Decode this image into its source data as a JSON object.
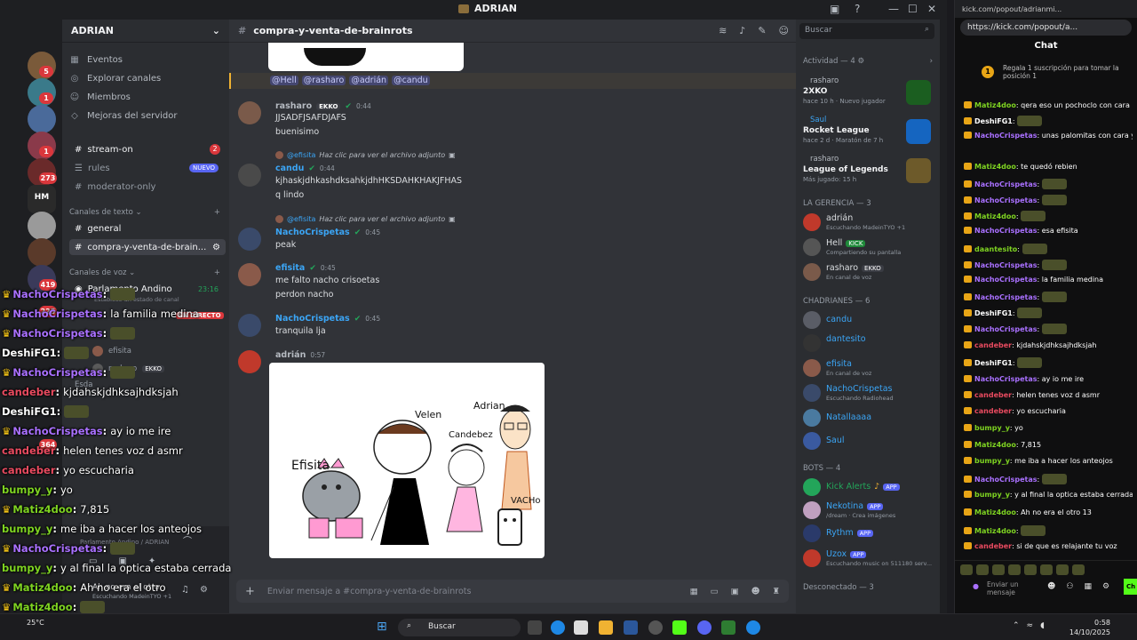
{
  "window": {
    "title": "ADRIAN"
  },
  "server": {
    "name": "ADRIAN",
    "rail_badges": [
      "5",
      "1",
      "1",
      "273",
      "HM",
      "419",
      "225",
      "364"
    ],
    "nav": [
      {
        "label": "Eventos",
        "icon": "calendar-icon"
      },
      {
        "label": "Explorar canales",
        "icon": "compass-icon"
      },
      {
        "label": "Miembros",
        "icon": "members-icon"
      },
      {
        "label": "Mejoras del servidor",
        "icon": "boost-icon"
      }
    ],
    "channels_top": [
      {
        "label": "stream-on",
        "badge": "2"
      },
      {
        "label": "rules",
        "badge": "NUEVO"
      },
      {
        "label": "moderator-only"
      }
    ],
    "text_category": "Canales de texto",
    "text_channels": [
      "general",
      "compra-y-venta-de-brain..."
    ],
    "voice_category": "Canales de voz",
    "voice_channel": {
      "name": "Parlamento Andino",
      "time": "23:16",
      "status": "Establece un estado de canal",
      "live": "EN DIRECTO"
    },
    "voice_users": [
      "efisita",
      "rasharo",
      "Esda"
    ],
    "voice_panel": {
      "line1": "Parlamento Andino / ADRIAN",
      "user": "Ah no era el otro",
      "status": "Escuchando MadeinTYO +1"
    }
  },
  "chat": {
    "channel": "compra-y-venta-de-brainrots",
    "mentions": [
      "@Hell",
      "@rasharo",
      "@adrián",
      "@candu"
    ],
    "messages": [
      {
        "author": "rasharo",
        "color": "#b5bac1",
        "time": "0:44",
        "tag": "EKKO",
        "lines": [
          "JJSADFJSAFDJAFS",
          "buenisimo"
        ]
      },
      {
        "reply_user": "@efisita",
        "reply_text": "Haz clic para ver el archivo adjunto",
        "author": "candu",
        "color": "#3ba5f5",
        "time": "0:44",
        "lines": [
          "kjhaskjdhkashdksahkjdhHKSDAHKHAKJFHAS",
          "q lindo"
        ]
      },
      {
        "reply_user": "@efisita",
        "reply_text": "Haz clic para ver el archivo adjunto",
        "author": "NachoCrispetas",
        "color": "#3ba5f5",
        "time": "0:45",
        "lines": [
          "peak"
        ]
      },
      {
        "author": "efisita",
        "color": "#3ba5f5",
        "time": "0:45",
        "lines": [
          "me falto nacho crisoetas",
          "perdon nacho"
        ]
      },
      {
        "author": "NachoCrispetas",
        "color": "#3ba5f5",
        "time": "0:45",
        "lines": [
          "tranquila lja"
        ]
      },
      {
        "author": "adrián",
        "color": "#b5bac1",
        "time": "0:57",
        "lines": []
      }
    ],
    "drawing_labels": [
      "Efisita",
      "Velen",
      "Candebez",
      "Adrian",
      "VACHo"
    ],
    "composer_placeholder": "Enviar mensaje a #compra-y-venta-de-brainrots"
  },
  "members": {
    "search_placeholder": "Buscar",
    "activity_title": "Actividad — 4",
    "activities": [
      {
        "user": "rasharo",
        "game": "2XKO",
        "sub": "hace 10 h · Nuevo jugador",
        "color": "#2e7d32"
      },
      {
        "user": "Saul",
        "game": "Rocket League",
        "sub": "hace 2 d · Maratón de 7 h",
        "color": "#1565c0"
      },
      {
        "user": "rasharo",
        "game": "League of Legends",
        "sub": "Más jugado: 15 h",
        "color": "#8d6e2a"
      }
    ],
    "gerencia_title": "LA GERENCIA — 3",
    "gerencia": [
      {
        "name": "adrián",
        "status": "Escuchando MadeinTYO +1"
      },
      {
        "name": "Hell",
        "tag": "KICK",
        "status": "Compartiendo su pantalla"
      },
      {
        "name": "rasharo",
        "tag": "EKKO",
        "status": "En canal de voz"
      }
    ],
    "chadrianes_title": "CHADRIANES — 6",
    "chadrianes": [
      {
        "name": "candu",
        "status": ""
      },
      {
        "name": "dantesito",
        "status": ""
      },
      {
        "name": "efisita",
        "status": "En canal de voz"
      },
      {
        "name": "NachoCrispetas",
        "status": "Escuchando Radiohead"
      },
      {
        "name": "Natallaaaa",
        "status": ""
      },
      {
        "name": "Saul",
        "status": ""
      }
    ],
    "bots_title": "BOTS — 4",
    "bots": [
      {
        "name": "Kick Alerts",
        "status": ""
      },
      {
        "name": "Nekotina",
        "status": "/dream · Crea imágenes"
      },
      {
        "name": "Rythm",
        "status": ""
      },
      {
        "name": "Uzox",
        "status": "Escuchando music on 511180 serv..."
      }
    ],
    "offline_title": "Desconectado — 3",
    "app_tag": "APP"
  },
  "kick": {
    "url_short": "kick.com/popout/adrianmi...",
    "url": "https://kick.com/popout/a...",
    "title": "Chat",
    "promo": "Regala 1 suscripción para tomar la posición 1",
    "messages": [
      {
        "user": "Matiz4doo",
        "color": "#7ed321",
        "text": "qera eso un pochoclo con cara"
      },
      {
        "user": "DeshiFG1",
        "color": "#ffffff",
        "text": ""
      },
      {
        "user": "NachoCrispetas",
        "color": "#a970ff",
        "text": "unas palomitas con cara y listo"
      },
      {
        "user": "Matiz4doo",
        "color": "#7ed321",
        "text": "te quedó rebien"
      },
      {
        "user": "NachoCrispetas",
        "color": "#a970ff",
        "text": ""
      },
      {
        "user": "NachoCrispetas",
        "color": "#a970ff",
        "text": ""
      },
      {
        "user": "Matiz4doo",
        "color": "#7ed321",
        "text": ""
      },
      {
        "user": "NachoCrispetas",
        "color": "#a970ff",
        "text": "esa efisita"
      },
      {
        "user": "daantesito",
        "color": "#7ed321",
        "text": ""
      },
      {
        "user": "NachoCrispetas",
        "color": "#a970ff",
        "text": ""
      },
      {
        "user": "NachoCrispetas",
        "color": "#a970ff",
        "text": "la familia medina"
      },
      {
        "user": "NachoCrispetas",
        "color": "#a970ff",
        "text": ""
      },
      {
        "user": "DeshiFG1",
        "color": "#ffffff",
        "text": ""
      },
      {
        "user": "NachoCrispetas",
        "color": "#a970ff",
        "text": ""
      },
      {
        "user": "candeber",
        "color": "#e84a5f",
        "text": "kjdahskjdhksajhdksjah"
      },
      {
        "user": "DeshiFG1",
        "color": "#ffffff",
        "text": ""
      },
      {
        "user": "NachoCrispetas",
        "color": "#a970ff",
        "text": "ay io me ire"
      },
      {
        "user": "candeber",
        "color": "#e84a5f",
        "text": "helen tenes voz d asmr"
      },
      {
        "user": "candeber",
        "color": "#e84a5f",
        "text": "yo escucharia"
      },
      {
        "user": "bumpy_y",
        "color": "#7ed321",
        "text": "yo"
      },
      {
        "user": "Matiz4doo",
        "color": "#7ed321",
        "text": "7,815"
      },
      {
        "user": "bumpy_y",
        "color": "#7ed321",
        "text": "me iba a hacer los anteojos"
      },
      {
        "user": "NachoCrispetas",
        "color": "#a970ff",
        "text": ""
      },
      {
        "user": "bumpy_y",
        "color": "#7ed321",
        "text": "y al final la optica estaba cerrada"
      },
      {
        "user": "Matiz4doo",
        "color": "#7ed321",
        "text": "Ah no era el otro 13"
      },
      {
        "user": "Matiz4doo",
        "color": "#7ed321",
        "text": ""
      },
      {
        "user": "candeber",
        "color": "#e84a5f",
        "text": "si de que es relajante tu voz"
      }
    ],
    "send_label": "Enviar un mensaje",
    "chat_button": "Ch"
  },
  "overlay": [
    {
      "user": "NachoCrispetas",
      "color": "#a970ff",
      "text": "",
      "crown": true
    },
    {
      "user": "NachoCrispetas",
      "color": "#a970ff",
      "text": "la familia medina",
      "crown": true
    },
    {
      "user": "NachoCrispetas",
      "color": "#a970ff",
      "text": "",
      "crown": true
    },
    {
      "user": "DeshiFG1",
      "color": "#ffffff",
      "text": "",
      "crown": false
    },
    {
      "user": "NachoCrispetas",
      "color": "#a970ff",
      "text": "",
      "crown": true
    },
    {
      "user": "candeber",
      "color": "#e84a5f",
      "text": "kjdahskjdhksajhdksjah",
      "crown": false
    },
    {
      "user": "DeshiFG1",
      "color": "#ffffff",
      "text": "",
      "crown": false
    },
    {
      "user": "NachoCrispetas",
      "color": "#a970ff",
      "text": "ay io me ire",
      "crown": true
    },
    {
      "user": "candeber",
      "color": "#e84a5f",
      "text": "helen tenes voz d asmr",
      "crown": false
    },
    {
      "user": "candeber",
      "color": "#e84a5f",
      "text": "yo escucharia",
      "crown": false
    },
    {
      "user": "bumpy_y",
      "color": "#7ed321",
      "text": "yo",
      "crown": false
    },
    {
      "user": "Matiz4doo",
      "color": "#7ed321",
      "text": "7,815",
      "crown": true
    },
    {
      "user": "bumpy_y",
      "color": "#7ed321",
      "text": "me iba a hacer los anteojos",
      "crown": false
    },
    {
      "user": "NachoCrispetas",
      "color": "#a970ff",
      "text": "",
      "crown": true
    },
    {
      "user": "bumpy_y",
      "color": "#7ed321",
      "text": "y al final la optica estaba cerrada",
      "crown": false
    },
    {
      "user": "Matiz4doo",
      "color": "#7ed321",
      "text": "Ah no era el otro",
      "crown": true
    },
    {
      "user": "Matiz4doo",
      "color": "#7ed321",
      "text": "",
      "crown": true
    },
    {
      "user": "candeber",
      "color": "#e84a5f",
      "text": "si de que es relajante tu voz",
      "crown": false
    }
  ],
  "taskbar": {
    "search": "Buscar",
    "weather_temp": "25°C",
    "time": "0:58",
    "date": "14/10/2025"
  }
}
